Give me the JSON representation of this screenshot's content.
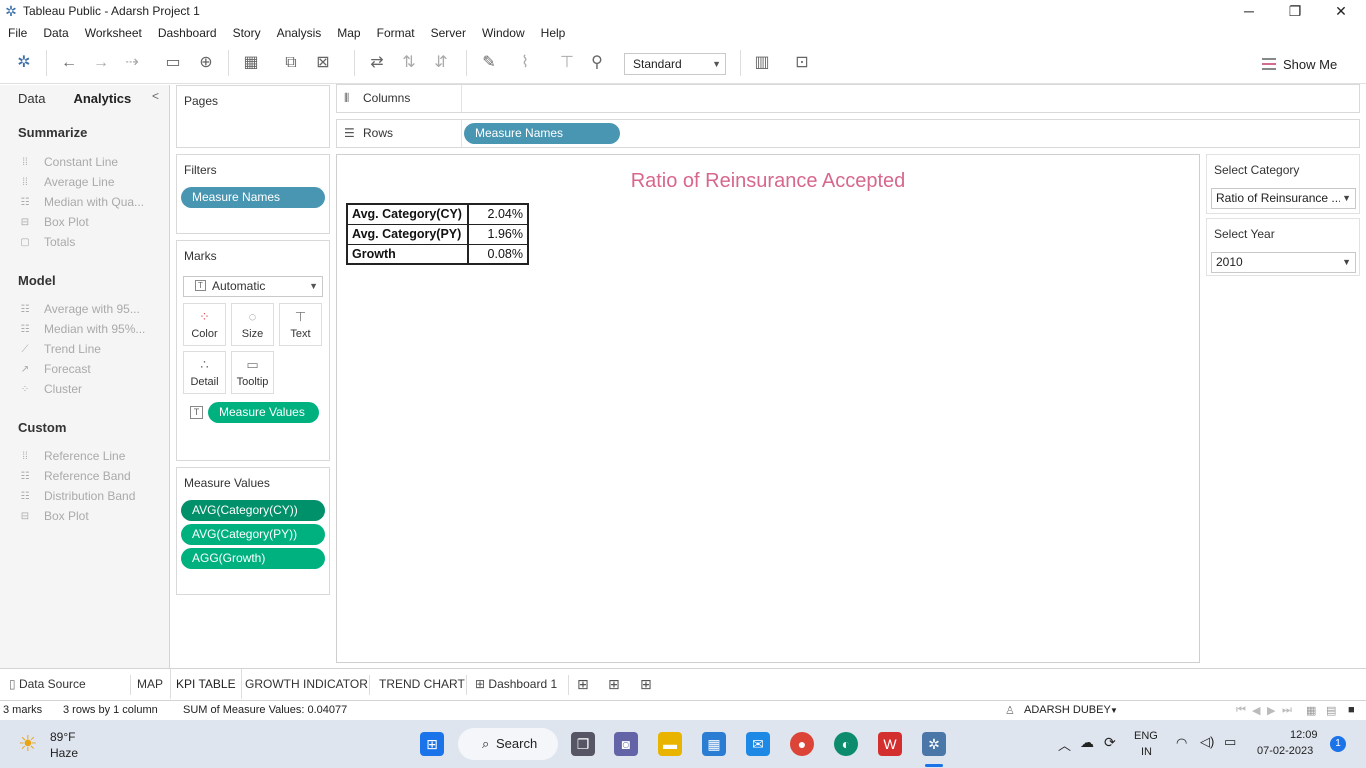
{
  "window": {
    "title": "Tableau Public - Adarsh Project 1"
  },
  "menu": [
    "File",
    "Data",
    "Worksheet",
    "Dashboard",
    "Story",
    "Analysis",
    "Map",
    "Format",
    "Server",
    "Window",
    "Help"
  ],
  "toolbar": {
    "fit": "Standard",
    "show_me": "Show Me"
  },
  "left_panel": {
    "tabs": [
      "Data",
      "Analytics"
    ],
    "summarize": {
      "title": "Summarize",
      "items": [
        "Constant Line",
        "Average Line",
        "Median with Qua...",
        "Box Plot",
        "Totals"
      ]
    },
    "model": {
      "title": "Model",
      "items": [
        "Average with 95...",
        "Median with 95%...",
        "Trend Line",
        "Forecast",
        "Cluster"
      ]
    },
    "custom": {
      "title": "Custom",
      "items": [
        "Reference Line",
        "Reference Band",
        "Distribution Band",
        "Box Plot"
      ]
    }
  },
  "pages": {
    "title": "Pages"
  },
  "filters": {
    "title": "Filters",
    "pills": [
      "Measure Names"
    ]
  },
  "marks": {
    "title": "Marks",
    "type": "Automatic",
    "buttons": [
      "Color",
      "Size",
      "Text",
      "Detail",
      "Tooltip"
    ],
    "text_pill": "Measure Values"
  },
  "measure_values": {
    "title": "Measure Values",
    "pills": [
      "AVG(Category(CY))",
      "AVG(Category(PY))",
      "AGG(Growth)"
    ]
  },
  "shelves": {
    "columns_label": "Columns",
    "rows_label": "Rows",
    "rows_pill": "Measure Names"
  },
  "view": {
    "title": "Ratio of Reinsurance Accepted",
    "rows": [
      {
        "label": "Avg. Category(CY)",
        "value": "2.04%"
      },
      {
        "label": "Avg. Category(PY)",
        "value": "1.96%"
      },
      {
        "label": "Growth",
        "value": "0.08%"
      }
    ]
  },
  "filter_panels": {
    "category": {
      "title": "Select Category",
      "value": "Ratio of Reinsurance ..."
    },
    "year": {
      "title": "Select Year",
      "value": "2010"
    }
  },
  "sheet_tabs": {
    "data_source": "Data Source",
    "sheets": [
      "MAP",
      "KPI TABLE",
      "GROWTH INDICATOR",
      "TREND CHART",
      "Dashboard 1"
    ],
    "active": "KPI TABLE"
  },
  "status": {
    "marks": "3 marks",
    "dims": "3 rows by 1 column",
    "sum": "SUM of Measure Values: 0.04077",
    "user": "ADARSH DUBEY"
  },
  "taskbar": {
    "temp": "89°F",
    "weather": "Haze",
    "search": "Search",
    "lang1": "ENG",
    "lang2": "IN",
    "time": "12:09",
    "date": "07-02-2023",
    "notif": "1"
  }
}
